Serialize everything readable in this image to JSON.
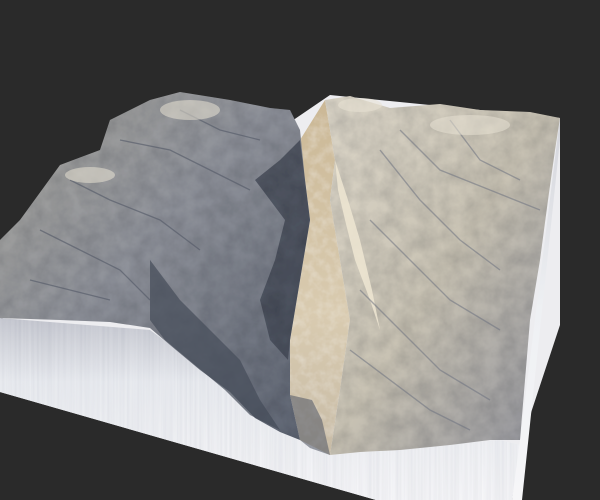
{
  "scene": {
    "background_color": "#2a2a2a",
    "terrain_light": "#e6dccb",
    "terrain_mid": "#b9ad98",
    "terrain_shadow": "#4e5563",
    "terrain_deep_shadow": "#3a3f4a",
    "canyon_sand": "#d8c8a8",
    "base_color": "#f2f2f4",
    "base_shadow": "#dcdde2"
  }
}
